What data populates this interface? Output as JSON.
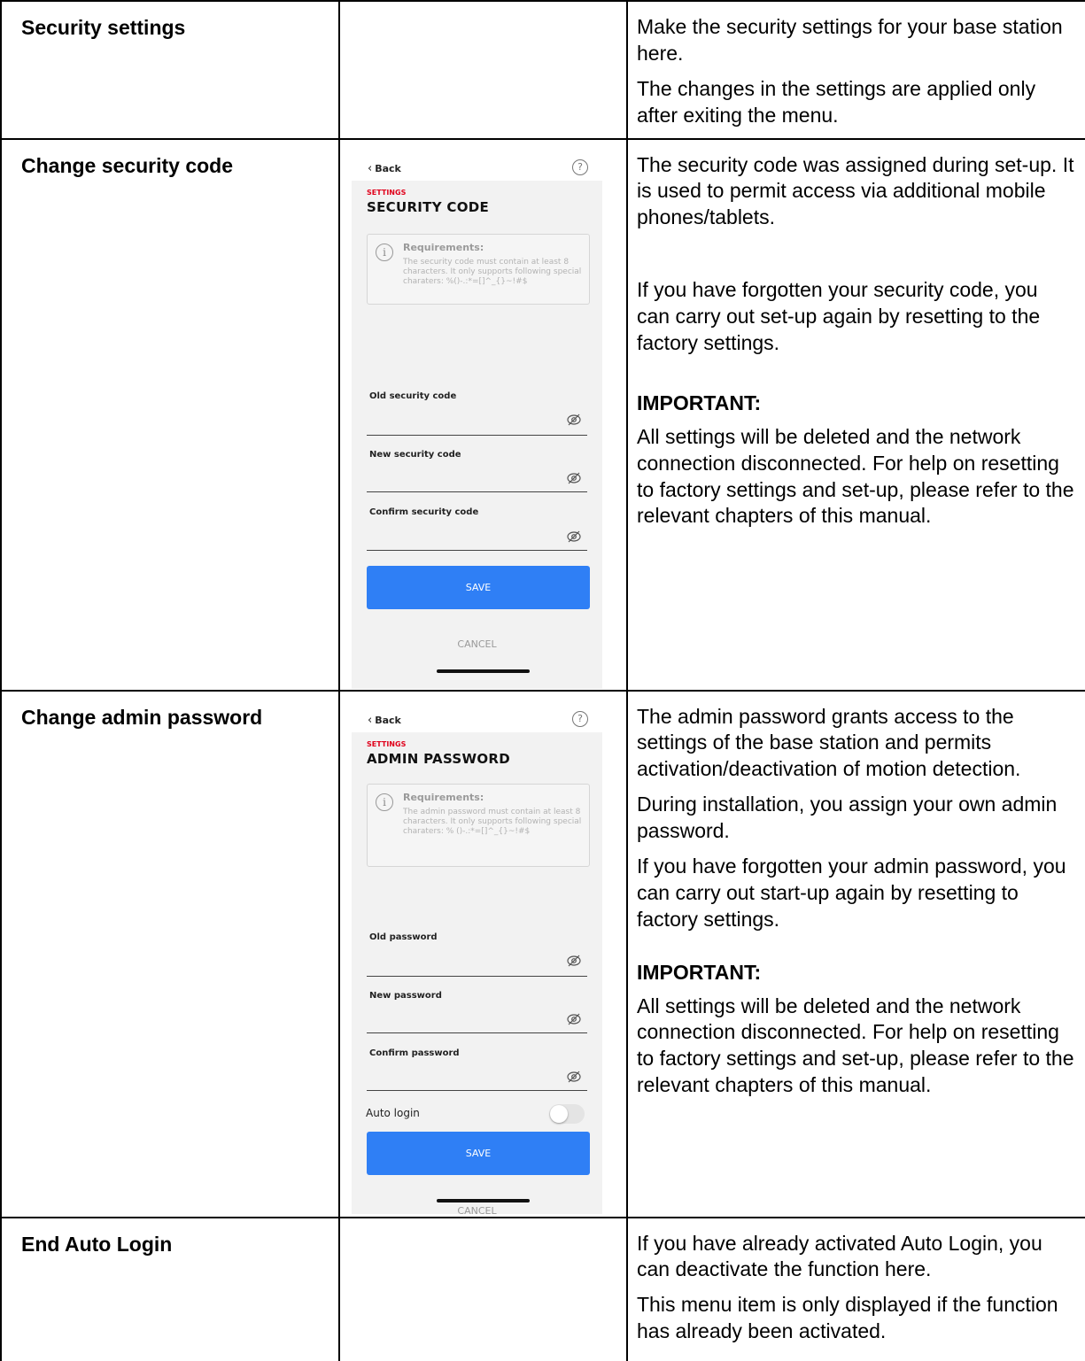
{
  "rows": {
    "security_settings": {
      "label": "Security settings",
      "desc": [
        "Make the security settings for your base station here.",
        "The changes in the settings are applied only after exiting the menu."
      ]
    },
    "change_security_code": {
      "label": "Change security code",
      "desc": [
        "The security code was assigned during set-up. It is used to permit access via additional mobile phones/tablets.",
        "If you have forgotten your security code, you can carry out set-up again by resetting to the factory settings."
      ],
      "important_title": "IMPORTANT:",
      "important_text": "All settings will be deleted and the network connection disconnected. For help on resetting to factory settings and set-up, please refer to the relevant chapters of this manual.",
      "screen": {
        "back": "Back",
        "help": "?",
        "kicker": "SETTINGS",
        "title": "SECURITY CODE",
        "req_title": "Requirements:",
        "req_text": "The security code must contain at least 8 characters. It only supports following special charaters: %()-.:*=[]^_{}~!#$",
        "field1": "Old security code",
        "field2": "New security code",
        "field3": "Confirm security code",
        "save": "SAVE",
        "cancel": "CANCEL"
      }
    },
    "change_admin_password": {
      "label": "Change admin password",
      "desc": [
        "The admin password grants access to the settings of the base station and permits activation/deactivation of motion detection.",
        "During installation, you assign your own admin password.",
        "If you have forgotten your admin password, you can carry out start-up again by resetting to factory settings."
      ],
      "important_title": "IMPORTANT:",
      "important_text": "All settings will be deleted and the network connection disconnected. For help on resetting to factory settings and set-up, please refer to the relevant chapters of this manual.",
      "screen": {
        "back": "Back",
        "help": "?",
        "kicker": "SETTINGS",
        "title": "ADMIN PASSWORD",
        "req_title": "Requirements:",
        "req_text": "The admin password must contain at least 8 characters. It only supports following special charaters: % ()-.:*=[]^_{}~!#$",
        "field1": "Old password",
        "field2": "New password",
        "field3": "Confirm password",
        "auto_login": "Auto login",
        "auto_login_on": false,
        "save": "SAVE",
        "cancel": "CANCEL"
      }
    },
    "end_auto_login": {
      "label": "End Auto Login",
      "desc": [
        "If you have already activated Auto Login, you can deactivate the function here.",
        "This menu item is only displayed if the function has already been activated."
      ]
    }
  },
  "colors": {
    "accent_blue": "#2f7ff5",
    "settings_red": "#e0001b"
  },
  "icons": {
    "back": "chevron-left-icon",
    "help": "question-circle-icon",
    "info": "info-circle-icon",
    "eye": "eye-hidden-icon"
  }
}
